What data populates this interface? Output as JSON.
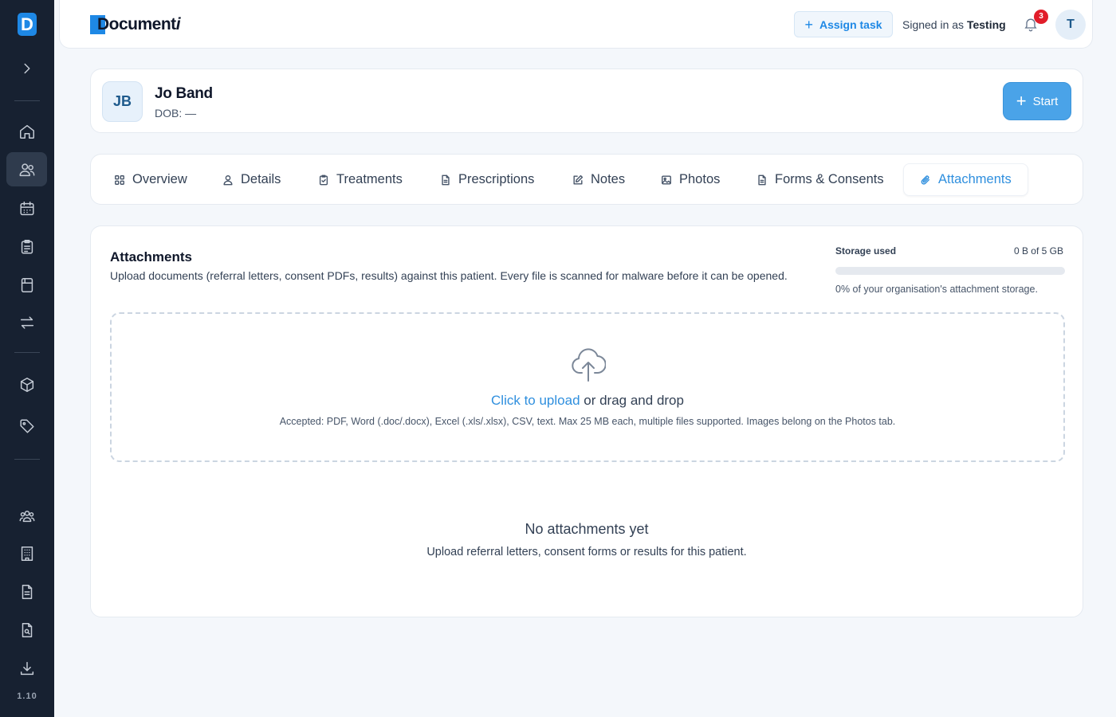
{
  "app": {
    "brand_name": "Document",
    "brand_suffix": "i",
    "side_logo_letter": "D",
    "version": "1.10",
    "accent_color": "#1e88e5"
  },
  "header": {
    "assign_task_label": "Assign task",
    "signed_in_prefix": "Signed in as",
    "user_name": "Testing",
    "notification_count": "3",
    "avatar_initial": "T"
  },
  "sidebar": {
    "items": [
      {
        "icon": "chevron-right-icon"
      },
      {
        "icon": "home-icon"
      },
      {
        "icon": "users-icon",
        "active": true
      },
      {
        "icon": "calendar-icon"
      },
      {
        "icon": "clipboard-icon"
      },
      {
        "icon": "form-icon"
      },
      {
        "icon": "transfer-icon"
      },
      {
        "icon": "box-icon"
      },
      {
        "icon": "tag-icon"
      },
      {
        "icon": "team-icon"
      },
      {
        "icon": "building-icon"
      },
      {
        "icon": "document-icon"
      },
      {
        "icon": "document-search-icon"
      },
      {
        "icon": "download-icon"
      }
    ]
  },
  "patient": {
    "initials": "JB",
    "name": "Jo Band",
    "dob": "DOB: —",
    "start_label": "Start"
  },
  "tabs": [
    {
      "label": "Overview",
      "icon": "grid-icon"
    },
    {
      "label": "Details",
      "icon": "person-icon"
    },
    {
      "label": "Treatments",
      "icon": "clipboard-check-icon"
    },
    {
      "label": "Prescriptions",
      "icon": "file-icon"
    },
    {
      "label": "Notes",
      "icon": "edit-icon"
    },
    {
      "label": "Photos",
      "icon": "image-icon"
    },
    {
      "label": "Forms & Consents",
      "icon": "file-text-icon"
    },
    {
      "label": "Attachments",
      "icon": "paperclip-icon",
      "active": true
    }
  ],
  "attachments": {
    "title": "Attachments",
    "description": "Upload documents (referral letters, consent PDFs, results) against this patient. Every file is scanned for malware before it can be opened.",
    "storage_label": "Storage used",
    "storage_value": "0 B of 5 GB",
    "storage_percent": 0,
    "storage_note": "0% of your organisation's attachment storage.",
    "upload_link": "Click to upload",
    "upload_rest": "or drag and drop",
    "accepted_note": "Accepted: PDF, Word (.doc/.docx), Excel (.xls/.xlsx), CSV, text. Max 25 MB each, multiple files supported. Images belong on the Photos tab.",
    "empty_title": "No attachments yet",
    "empty_desc": "Upload referral letters, consent forms or results for this patient."
  }
}
